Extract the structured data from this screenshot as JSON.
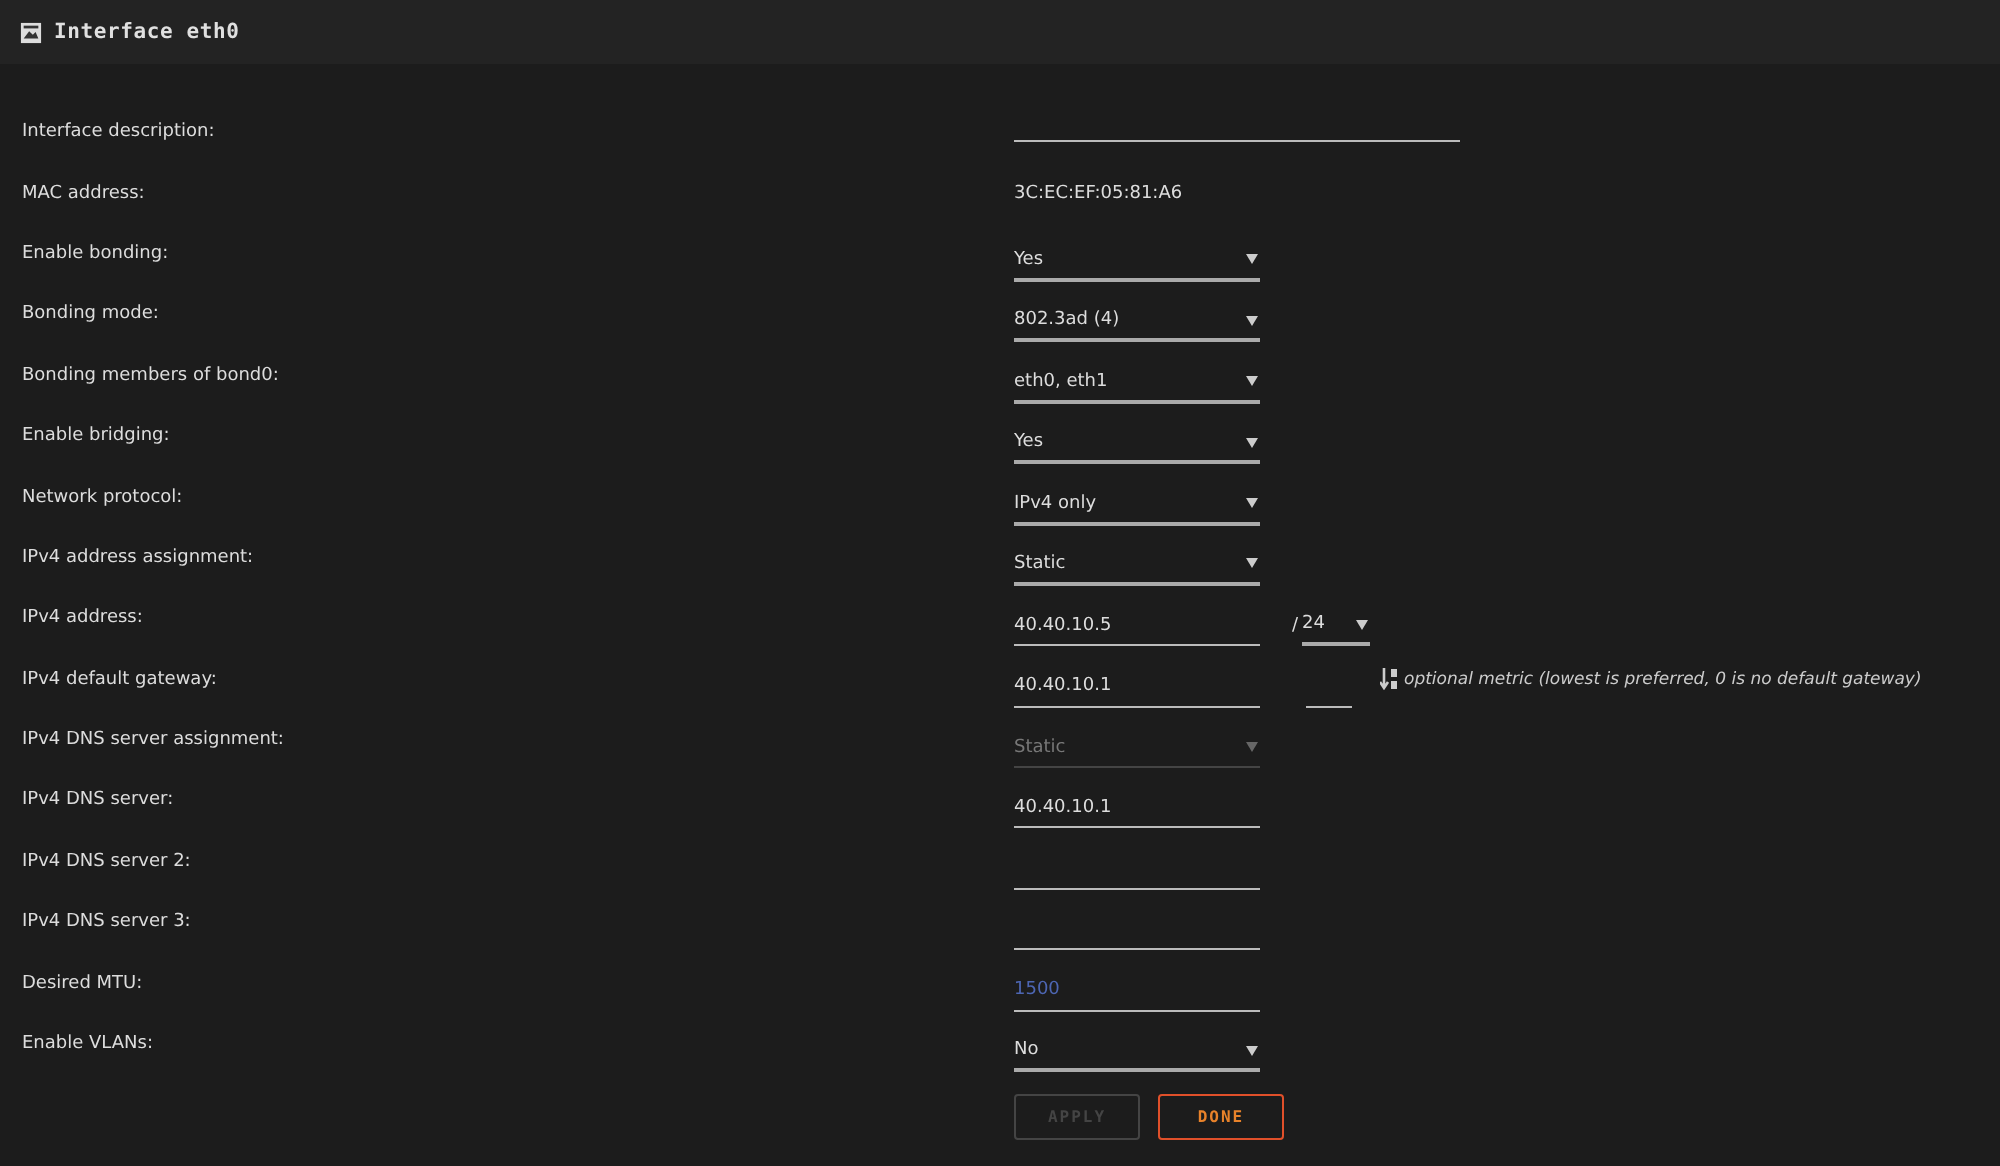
{
  "panel": {
    "title": "Interface eth0"
  },
  "rows": [
    {
      "label": "Interface description:",
      "kind": "input",
      "wide": true
    },
    {
      "label": "MAC address:",
      "kind": "static",
      "value": "3C:EC:EF:05:81:A6"
    },
    {
      "label": "Enable bonding:",
      "kind": "select",
      "value": "Yes",
      "disabled": false
    },
    {
      "label": "Bonding mode:",
      "kind": "select",
      "value": "802.3ad (4)",
      "disabled": false
    },
    {
      "label": "Bonding members of bond0:",
      "kind": "select",
      "value": "eth0, eth1",
      "disabled": false
    },
    {
      "label": "Enable bridging:",
      "kind": "select",
      "value": "Yes",
      "disabled": false
    },
    {
      "label": "Network protocol:",
      "kind": "select",
      "value": "IPv4 only",
      "disabled": false
    },
    {
      "label": "IPv4 address assignment:",
      "kind": "select",
      "value": "Static",
      "disabled": false
    },
    {
      "label": "IPv4 address:",
      "kind": "input",
      "value": "40.40.10.5",
      "mask": {
        "prefix": "/",
        "value": "24"
      }
    },
    {
      "label": "IPv4 default gateway:",
      "kind": "input",
      "value": "40.40.10.1",
      "metric": {
        "hint": "optional metric (lowest is preferred, 0 is no default gateway)"
      }
    },
    {
      "label": "IPv4 DNS server assignment:",
      "kind": "select",
      "value": "Static",
      "disabled": true
    },
    {
      "label": "IPv4 DNS server:",
      "kind": "input",
      "value": "40.40.10.1"
    },
    {
      "label": "IPv4 DNS server 2:",
      "kind": "input"
    },
    {
      "label": "IPv4 DNS server 3:",
      "kind": "input"
    },
    {
      "label": "Desired MTU:",
      "kind": "input",
      "placeholder": "1500"
    },
    {
      "label": "Enable VLANs:",
      "kind": "select",
      "value": "No",
      "disabled": false
    }
  ],
  "buttons": [
    {
      "label": "APPLY",
      "disabled": true,
      "kind": "secondary"
    },
    {
      "label": "DONE",
      "disabled": false,
      "kind": "primary"
    }
  ]
}
